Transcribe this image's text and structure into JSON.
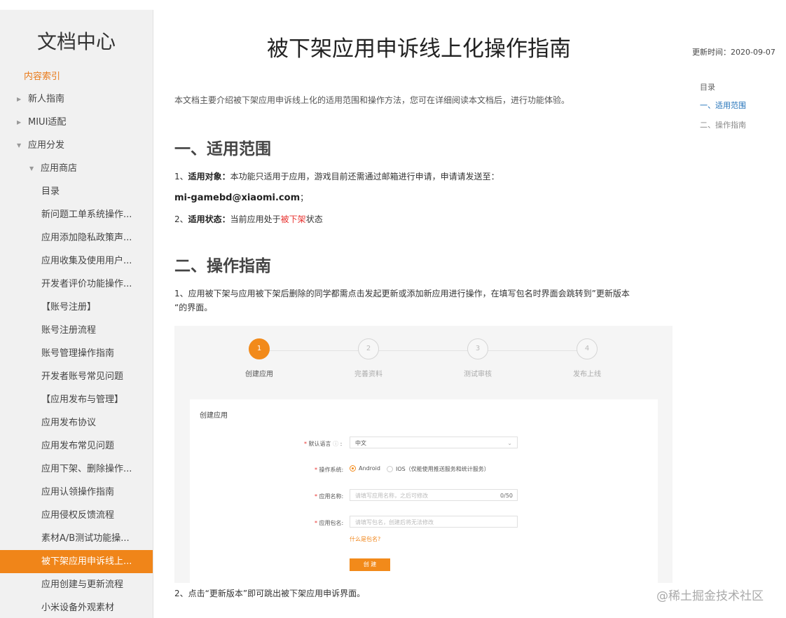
{
  "sidebar": {
    "logo": "文档中心",
    "index_label": "内容索引",
    "items": [
      {
        "label": "新人指南",
        "level": 0,
        "toggle": "▶"
      },
      {
        "label": "MIUI适配",
        "level": 0,
        "toggle": "▶"
      },
      {
        "label": "应用分发",
        "level": 0,
        "toggle": "▼"
      },
      {
        "label": "应用商店",
        "level": 1,
        "toggle": "▼"
      },
      {
        "label": "目录",
        "level": 2
      },
      {
        "label": "新问题工单系统操作...",
        "level": 2
      },
      {
        "label": "应用添加隐私政策声...",
        "level": 2
      },
      {
        "label": "应用收集及使用用户...",
        "level": 2
      },
      {
        "label": "开发者评价功能操作...",
        "level": 2
      },
      {
        "label": "【账号注册】",
        "level": 3
      },
      {
        "label": "账号注册流程",
        "level": 2
      },
      {
        "label": "账号管理操作指南",
        "level": 2
      },
      {
        "label": "开发者账号常见问题",
        "level": 2
      },
      {
        "label": "【应用发布与管理】",
        "level": 3
      },
      {
        "label": "应用发布协议",
        "level": 2
      },
      {
        "label": "应用发布常见问题",
        "level": 2
      },
      {
        "label": "应用下架、删除操作...",
        "level": 2
      },
      {
        "label": "应用认领操作指南",
        "level": 2
      },
      {
        "label": "应用侵权反馈流程",
        "level": 2
      },
      {
        "label": "素材A/B测试功能操...",
        "level": 2
      },
      {
        "label": "被下架应用申诉线上...",
        "level": 2,
        "active": true
      },
      {
        "label": "应用创建与更新流程",
        "level": 2
      },
      {
        "label": "小米设备外观素材",
        "level": 2
      }
    ]
  },
  "article": {
    "title": "被下架应用申诉线上化操作指南",
    "intro": "本文档主要介绍被下架应用申诉线上化的适用范围和操作方法，您可在详细阅读本文档后，进行功能体验。",
    "section1": "一、适用范围",
    "p1_prefix": "1、",
    "p1_bold": "适用对象：",
    "p1_text": "本功能只适用于应用，游戏目前还需通过邮箱进行申请，申请请发送至：",
    "email": "mi-gamebd@xiaomi.com",
    "email_suffix": "；",
    "p2_prefix": "2、",
    "p2_bold": "适用状态：",
    "p2_text": "当前应用处于",
    "p2_red": "被下架",
    "p2_suffix": "状态",
    "section2": "二、操作指南",
    "p3_line1": "1、应用被下架与应用被下架后删除的同学都需点击发起更新或添加新应用进行操作，在填写包名时界面会跳转到”更新版本",
    "p3_line2": "“的界面。",
    "p4": "2、点击“更新版本”即可跳出被下架应用申诉界面。"
  },
  "screenshot": {
    "steps": [
      {
        "num": "1",
        "label": "创建应用",
        "active": true
      },
      {
        "num": "2",
        "label": "完善资料",
        "active": false
      },
      {
        "num": "3",
        "label": "测试审核",
        "active": false
      },
      {
        "num": "4",
        "label": "发布上线",
        "active": false
      }
    ],
    "card_title": "创建应用",
    "lang_label": "默认语言",
    "lang_value": "中文",
    "os_label": "操作系统:",
    "os_android": "Android",
    "os_ios": "IOS（仅能使用推送服务和统计服务）",
    "name_label": "应用名称:",
    "name_placeholder": "请填写应用名称，之后可修改",
    "name_count": "0/50",
    "pkg_label": "应用包名:",
    "pkg_placeholder": "请填写包名，创建后将无法修改",
    "pkg_help": "什么是包名?",
    "create_button": "创 建"
  },
  "right": {
    "updated": "更新时间：2020-09-07",
    "toc_title": "目录",
    "toc": [
      "一、适用范围",
      "二、操作指南"
    ]
  },
  "watermark": "@稀土掘金技术社区",
  "colors": {
    "accent": "#f08519",
    "link": "#1e6fb8",
    "red": "#e8322f"
  }
}
